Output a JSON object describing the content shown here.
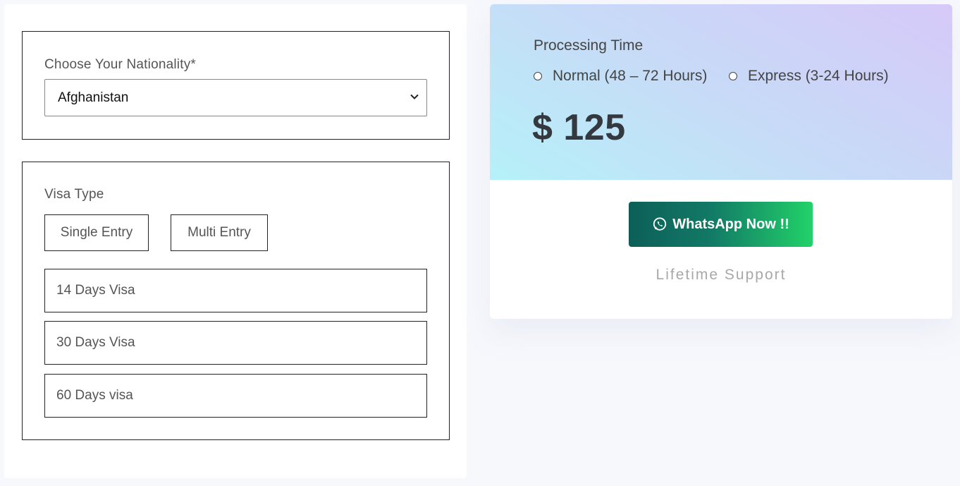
{
  "nationality": {
    "label": "Choose Your Nationality*",
    "selected": "Afghanistan"
  },
  "visa": {
    "label": "Visa Type",
    "entries": [
      "Single Entry",
      "Multi Entry"
    ],
    "durations": [
      "14 Days Visa",
      "30 Days Visa",
      "60 Days visa"
    ]
  },
  "processing": {
    "title": "Processing Time",
    "options": [
      "Normal (48 – 72 Hours)",
      "Express (3-24 Hours)"
    ]
  },
  "price": "$ 125",
  "cta": {
    "label": "WhatsApp Now !!",
    "icon": "whatsapp-icon"
  },
  "support_text": "Lifetime Support",
  "colors": {
    "whatsapp_start": "#0c5f58",
    "whatsapp_end": "#22d269",
    "header_gradient_start": "#b5f1f8",
    "header_gradient_end": "#d6c9f8"
  }
}
